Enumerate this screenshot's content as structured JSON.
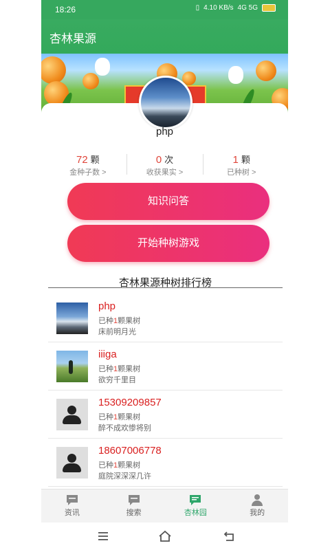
{
  "status_bar": {
    "time": "18:26",
    "network_speed": "4.10 KB/s",
    "signal": "4G 5G"
  },
  "app": {
    "title": "杏林果源"
  },
  "profile": {
    "username": "php"
  },
  "stats": [
    {
      "value": "72",
      "unit": "颗",
      "label": "金种子数 >"
    },
    {
      "value": "0",
      "unit": "次",
      "label": "收获果实 >"
    },
    {
      "value": "1",
      "unit": "颗",
      "label": "已种树 >"
    }
  ],
  "buttons": {
    "qa": "知识问答",
    "game": "开始种树游戏"
  },
  "ranking": {
    "title": "杏林果源种树排行榜",
    "items": [
      {
        "name": "php",
        "prefix": "已种",
        "count": "1",
        "suffix": "颗果树",
        "motto": "床前明月光",
        "avatar": "mountain"
      },
      {
        "name": "iiiga",
        "prefix": "已种",
        "count": "1",
        "suffix": "颗果树",
        "motto": "欲穷千里目",
        "avatar": "golf"
      },
      {
        "name": "15309209857",
        "prefix": "已种",
        "count": "1",
        "suffix": "颗果树",
        "motto": "醉不成欢惨将别",
        "avatar": "default"
      },
      {
        "name": "18607006778",
        "prefix": "已种",
        "count": "1",
        "suffix": "颗果树",
        "motto": "庭院深深深几许",
        "avatar": "default"
      }
    ]
  },
  "tabs": [
    {
      "label": "资讯",
      "icon": "chat-icon"
    },
    {
      "label": "搜索",
      "icon": "chat-icon"
    },
    {
      "label": "杏林园",
      "icon": "chat-icon",
      "active": true
    },
    {
      "label": "我的",
      "icon": "person-icon"
    }
  ],
  "colors": {
    "primary": "#36a85e",
    "button": "#f03a55",
    "accent": "#d91f1f",
    "active_tab": "#2fa66b"
  }
}
